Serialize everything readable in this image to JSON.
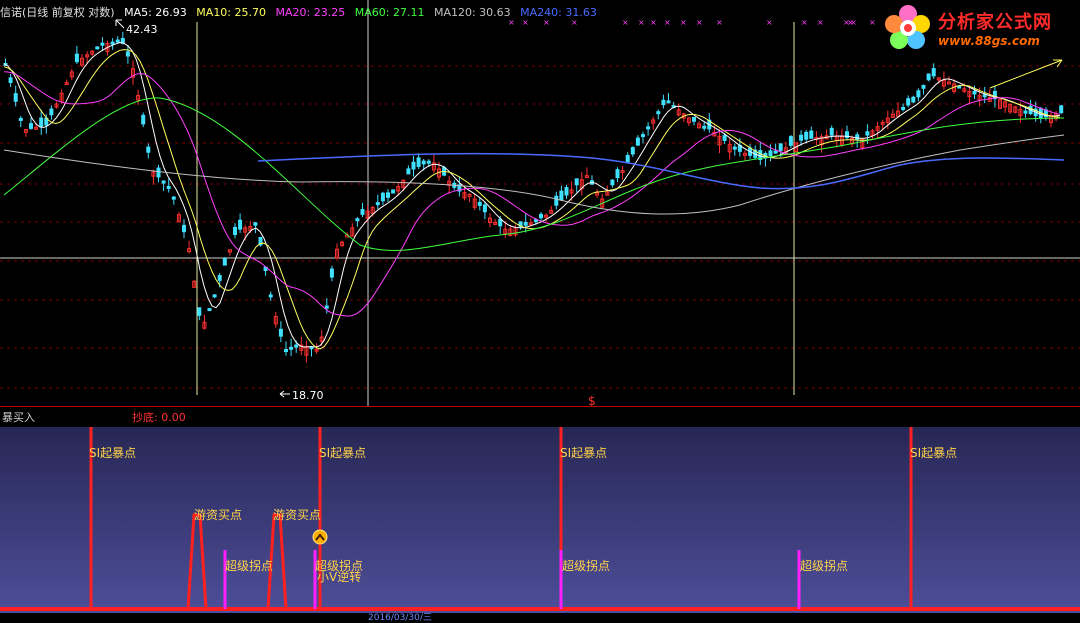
{
  "legend": {
    "title": "信诺(日线 前复权 对数)",
    "ma5": "MA5: 26.93",
    "ma10": "MA10: 25.70",
    "ma20": "MA20: 23.25",
    "ma60": "MA60: 27.11",
    "ma120": "MA120: 30.63",
    "ma240": "MA240: 31.63"
  },
  "colors": {
    "title": "#e0e0e0",
    "ma5": "#ffffff",
    "ma10": "#ffff60",
    "ma20": "#ff40ff",
    "ma60": "#40ff40",
    "ma120": "#c0c0c0",
    "ma240": "#4a6aff",
    "up": "#ff3030",
    "down": "#40e0ff",
    "signal": "#ff2020",
    "magenta_signal": "#ff20ff"
  },
  "logo": {
    "icon": "flower-logo-icon",
    "title": "分析家公式网",
    "url": "www.88gs.com"
  },
  "price_marks": {
    "high": "42.43",
    "low": "18.70",
    "dollar": "$"
  },
  "indicator": {
    "title": "暴买入",
    "chaodi": "抄底: 0.00",
    "labels": {
      "si1": "SI起暴点",
      "si2": "SI起暴点",
      "si3": "SI起暴点",
      "si4": "SI起暴点",
      "youzi1": "游资买点",
      "youzi2": "游资买点",
      "chaoji1": "超级拐点",
      "chaoji2": "超级拐点",
      "chaoji3": "超级拐点",
      "chaoji4": "超级拐点",
      "xiaov": "小V逆转"
    }
  },
  "axis": {
    "date": "2016/03/30/三"
  }
}
